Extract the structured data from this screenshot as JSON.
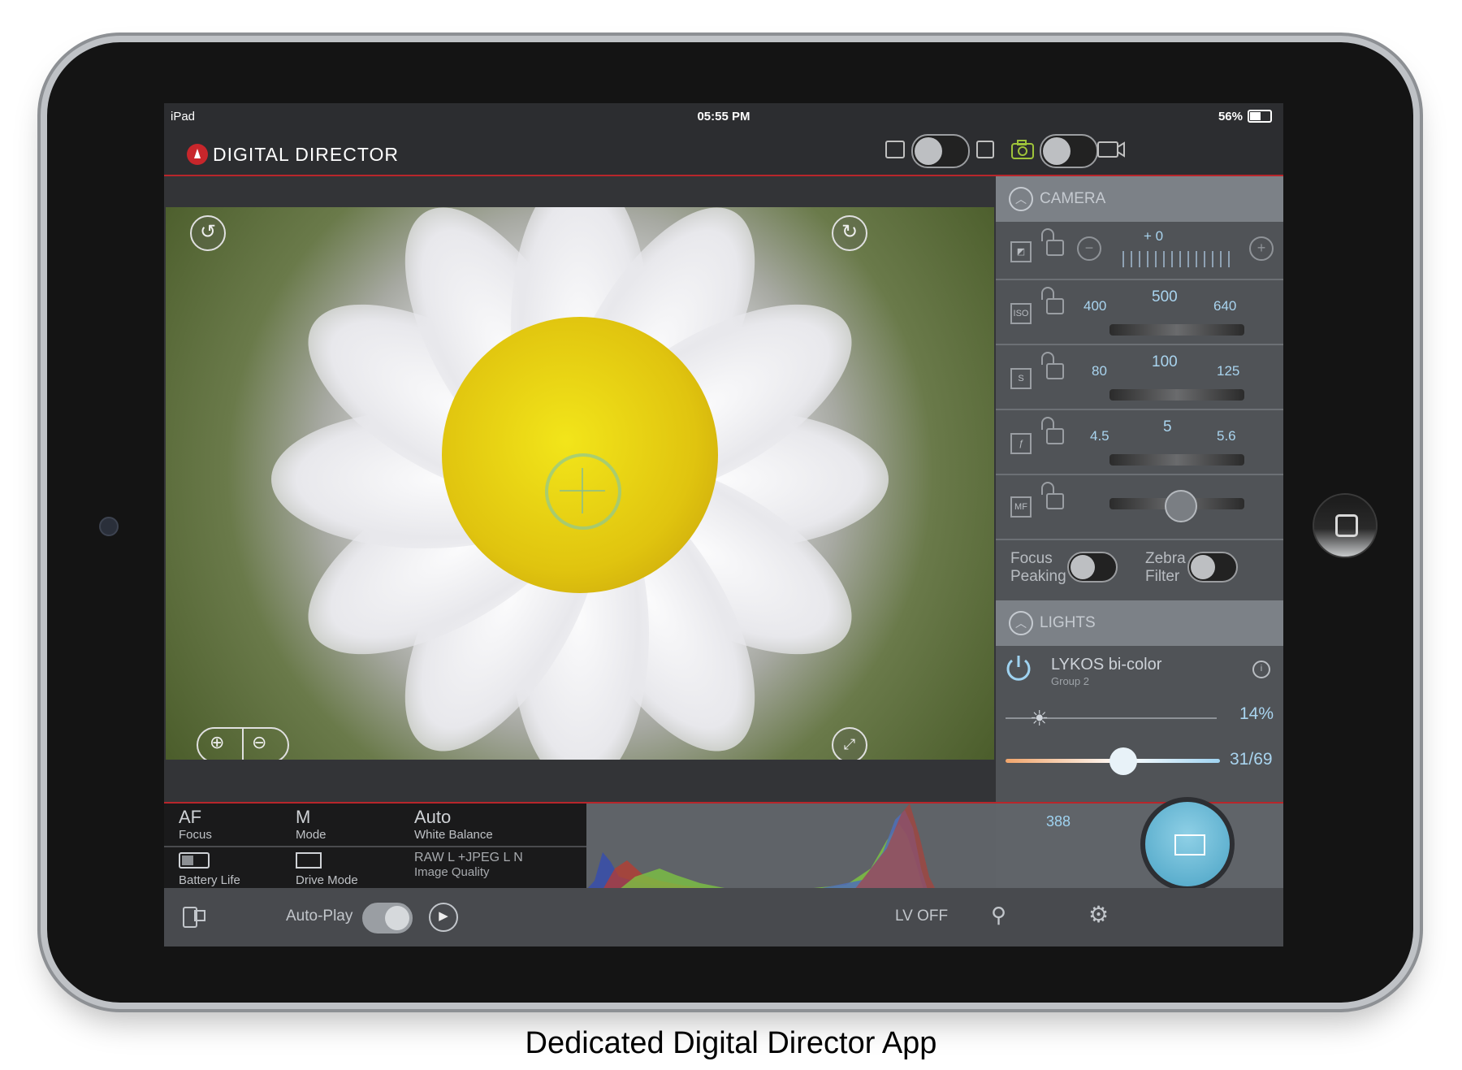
{
  "status_bar": {
    "device": "iPad",
    "time": "05:55 PM",
    "battery": "56%"
  },
  "header": {
    "app_title": "DIGITAL DIRECTOR"
  },
  "camera_panel": {
    "title": "CAMERA",
    "exposure": {
      "value": "+ 0"
    },
    "iso": {
      "prev": "400",
      "current": "500",
      "next": "640"
    },
    "shutter": {
      "prev": "80",
      "current": "100",
      "next": "125"
    },
    "aperture": {
      "prev": "4.5",
      "current": "5",
      "next": "5.6"
    },
    "focus_peaking_label": "Focus\nPeaking",
    "zebra_label": "Zebra\nFilter"
  },
  "lights_panel": {
    "title": "LIGHTS",
    "light_name": "LYKOS bi-color",
    "group": "Group 2",
    "brightness": "14%",
    "color_temp": "31/69",
    "color_temp_fraction": 0.55
  },
  "info": {
    "focus_value": "AF",
    "focus_label": "Focus",
    "mode_value": "M",
    "mode_label": "Mode",
    "wb_value": "Auto",
    "wb_label": "White Balance",
    "battery_label": "Battery Life",
    "drive_label": "Drive Mode",
    "quality_value": "RAW L +JPEG L N",
    "quality_label": "Image Quality"
  },
  "shot_count": "388",
  "toolbar": {
    "autoplay_label": "Auto-Play",
    "lv_label": "LV OFF"
  },
  "caption": "Dedicated Digital Director App",
  "colors": {
    "accent": "#b8262b",
    "value_blue": "#a9d4ef",
    "shutter": "#4aa3c5"
  }
}
